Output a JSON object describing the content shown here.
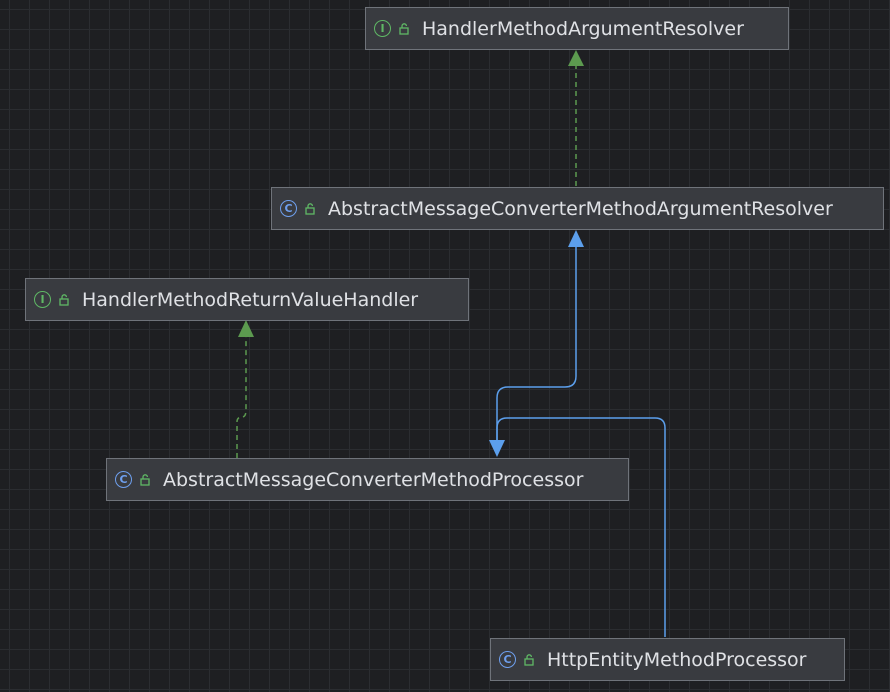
{
  "colors": {
    "background": "#1e1f22",
    "grid": "#2b2d31",
    "node_fill": "#393b40",
    "node_border": "#6f737a",
    "text": "#dfe1e5",
    "implements_edge": "#5c9a4f",
    "extends_edge": "#5c9fec"
  },
  "nodes": [
    {
      "name": "HandlerMethodArgumentResolver",
      "kind": "interface",
      "kind_letter": "I",
      "kind_icon": "interface-icon",
      "access_icon": "open-lock-icon"
    },
    {
      "name": "AbstractMessageConverterMethodArgumentResolver",
      "kind": "class",
      "kind_letter": "C",
      "kind_icon": "class-icon",
      "access_icon": "open-lock-icon"
    },
    {
      "name": "HandlerMethodReturnValueHandler",
      "kind": "interface",
      "kind_letter": "I",
      "kind_icon": "interface-icon",
      "access_icon": "open-lock-icon"
    },
    {
      "name": "AbstractMessageConverterMethodProcessor",
      "kind": "class",
      "kind_letter": "C",
      "kind_icon": "class-icon",
      "access_icon": "open-lock-icon"
    },
    {
      "name": "HttpEntityMethodProcessor",
      "kind": "class",
      "kind_letter": "C",
      "kind_icon": "class-icon",
      "access_icon": "open-lock-icon"
    }
  ],
  "edges": [
    {
      "from": "AbstractMessageConverterMethodArgumentResolver",
      "to": "HandlerMethodArgumentResolver",
      "relation": "implements"
    },
    {
      "from": "AbstractMessageConverterMethodProcessor",
      "to": "HandlerMethodReturnValueHandler",
      "relation": "implements"
    },
    {
      "from": "AbstractMessageConverterMethodProcessor",
      "to": "AbstractMessageConverterMethodArgumentResolver",
      "relation": "extends"
    },
    {
      "from": "HttpEntityMethodProcessor",
      "to": "AbstractMessageConverterMethodProcessor",
      "relation": "extends"
    }
  ]
}
